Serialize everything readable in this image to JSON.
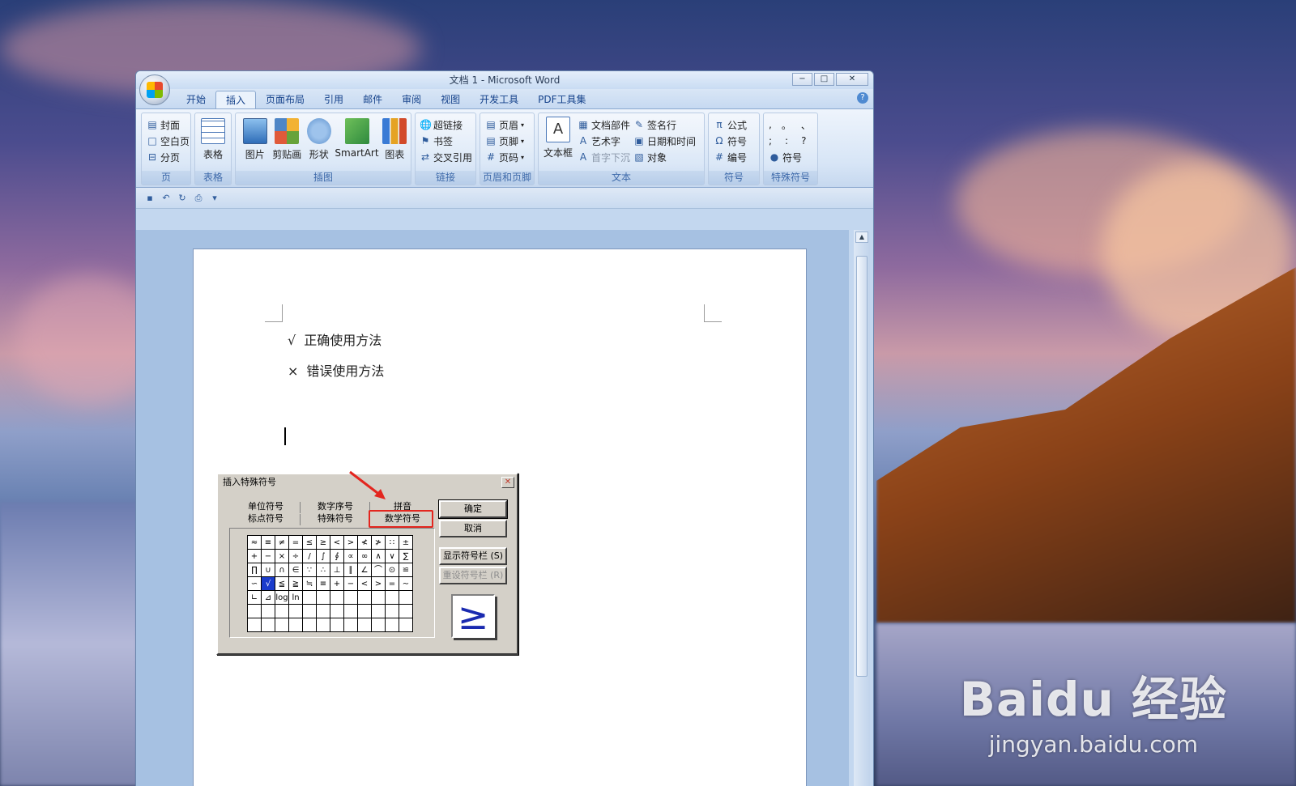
{
  "window": {
    "title": "文档 1 - Microsoft Word",
    "controls": {
      "minimize": "−",
      "maximize": "□",
      "close": "✕"
    }
  },
  "tabs": [
    "开始",
    "插入",
    "页面布局",
    "引用",
    "邮件",
    "审阅",
    "视图",
    "开发工具",
    "PDF工具集"
  ],
  "active_tab": "插入",
  "ribbon": {
    "groups": {
      "page": {
        "label": "页",
        "items": [
          "封面",
          "空白页",
          "分页"
        ]
      },
      "table": {
        "label": "表格",
        "items": [
          "表格"
        ]
      },
      "illustrations": {
        "label": "插图",
        "items": [
          "图片",
          "剪贴画",
          "形状",
          "SmartArt",
          "图表"
        ]
      },
      "links": {
        "label": "链接",
        "items": [
          "超链接",
          "书签",
          "交叉引用"
        ]
      },
      "header_footer": {
        "label": "页眉和页脚",
        "items": [
          "页眉",
          "页脚",
          "页码"
        ]
      },
      "text": {
        "label": "文本",
        "textbox": "文本框",
        "items": [
          "文档部件",
          "艺术字",
          "首字下沉",
          "签名行",
          "日期和时间",
          "对象"
        ]
      },
      "symbols": {
        "label": "符号",
        "items": [
          "公式",
          "符号",
          "编号"
        ]
      },
      "special": {
        "label": "特殊符号",
        "punct_row1": [
          ",",
          "。",
          "、"
        ],
        "punct_row2": [
          ";",
          ":",
          "?"
        ],
        "symbol_label": "符号"
      }
    }
  },
  "document": {
    "lines": [
      {
        "mark": "√",
        "text": "正确使用方法"
      },
      {
        "mark": "×",
        "text": "错误使用方法"
      }
    ]
  },
  "dialog": {
    "title": "插入特殊符号",
    "tabs_row1": [
      "单位符号",
      "数字序号",
      "拼音"
    ],
    "tabs_row2": [
      "标点符号",
      "特殊符号",
      "数学符号"
    ],
    "selected_tab": "数学符号",
    "buttons": {
      "ok": "确定",
      "cancel": "取消",
      "show_bar": "显示符号栏 (S)",
      "reset_bar": "重设符号栏 (R)"
    },
    "grid": [
      [
        "≈",
        "≡",
        "≠",
        "=",
        "≤",
        "≥",
        "<",
        ">",
        "≮",
        "≯",
        "∷",
        "±"
      ],
      [
        "+",
        "−",
        "×",
        "÷",
        "/",
        "∫",
        "∮",
        "∝",
        "∞",
        "∧",
        "∨",
        "∑"
      ],
      [
        "∏",
        "∪",
        "∩",
        "∈",
        "∵",
        "∴",
        "⊥",
        "∥",
        "∠",
        "⌒",
        "⊙",
        "≌"
      ],
      [
        "∽",
        "√",
        "≦",
        "≧",
        "≒",
        "≡",
        "+",
        "−",
        "<",
        ">",
        "=",
        "∼"
      ],
      [
        "∟",
        "⊿",
        "log",
        "ln",
        "",
        "",
        "",
        "",
        "",
        "",
        "",
        ""
      ],
      [
        "",
        "",
        "",
        "",
        "",
        "",
        "",
        "",
        "",
        "",
        "",
        ""
      ],
      [
        "",
        "",
        "",
        "",
        "",
        "",
        "",
        "",
        "",
        "",
        "",
        ""
      ]
    ],
    "selected_cell": "√",
    "preview": "≥"
  },
  "watermark": {
    "brand": "Baidu 经验",
    "url": "jingyan.baidu.com"
  },
  "colors": {
    "highlight_box": "#e3261f",
    "selected_cell": "#1a3ccc",
    "ribbon_label": "#3e6aaa"
  }
}
